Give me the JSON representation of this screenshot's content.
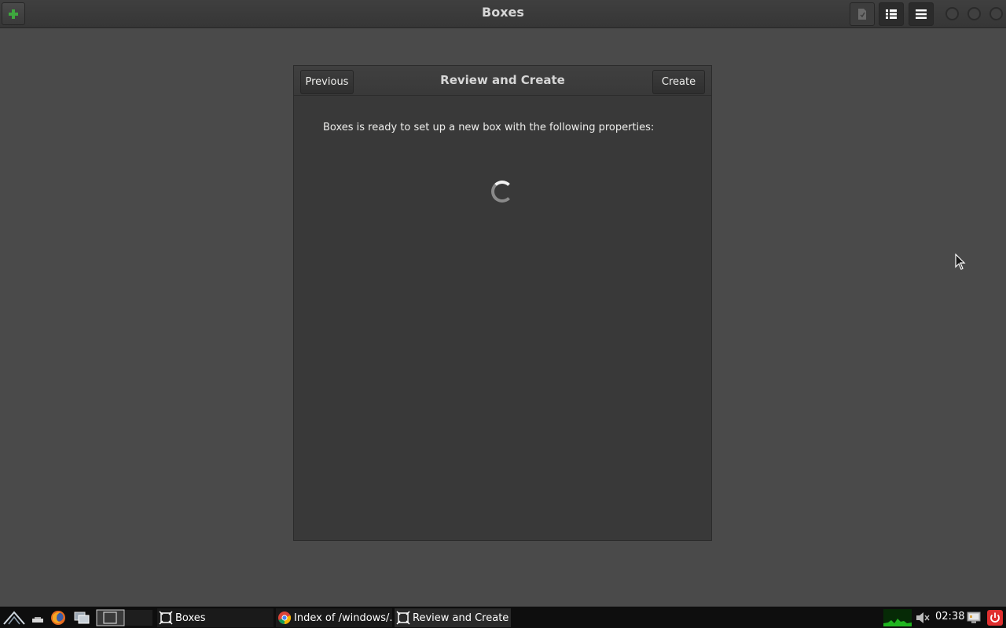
{
  "window": {
    "title": "Boxes"
  },
  "dialog": {
    "title": "Review and Create",
    "previous_label": "Previous",
    "create_label": "Create",
    "description": "Boxes is ready to set up a new box with the following properties:"
  },
  "taskbar": {
    "tasks": [
      {
        "label": "Boxes"
      },
      {
        "label": "Index of /windows/..."
      },
      {
        "label": "Review and Create"
      }
    ],
    "clock": "02:38"
  },
  "colors": {
    "accent_green": "#3ea83e",
    "power_red": "#e03030"
  },
  "icons": {
    "new": "plus-icon",
    "selection": "selection-mode-icon",
    "list": "list-view-icon",
    "menu": "hamburger-menu-icon"
  }
}
